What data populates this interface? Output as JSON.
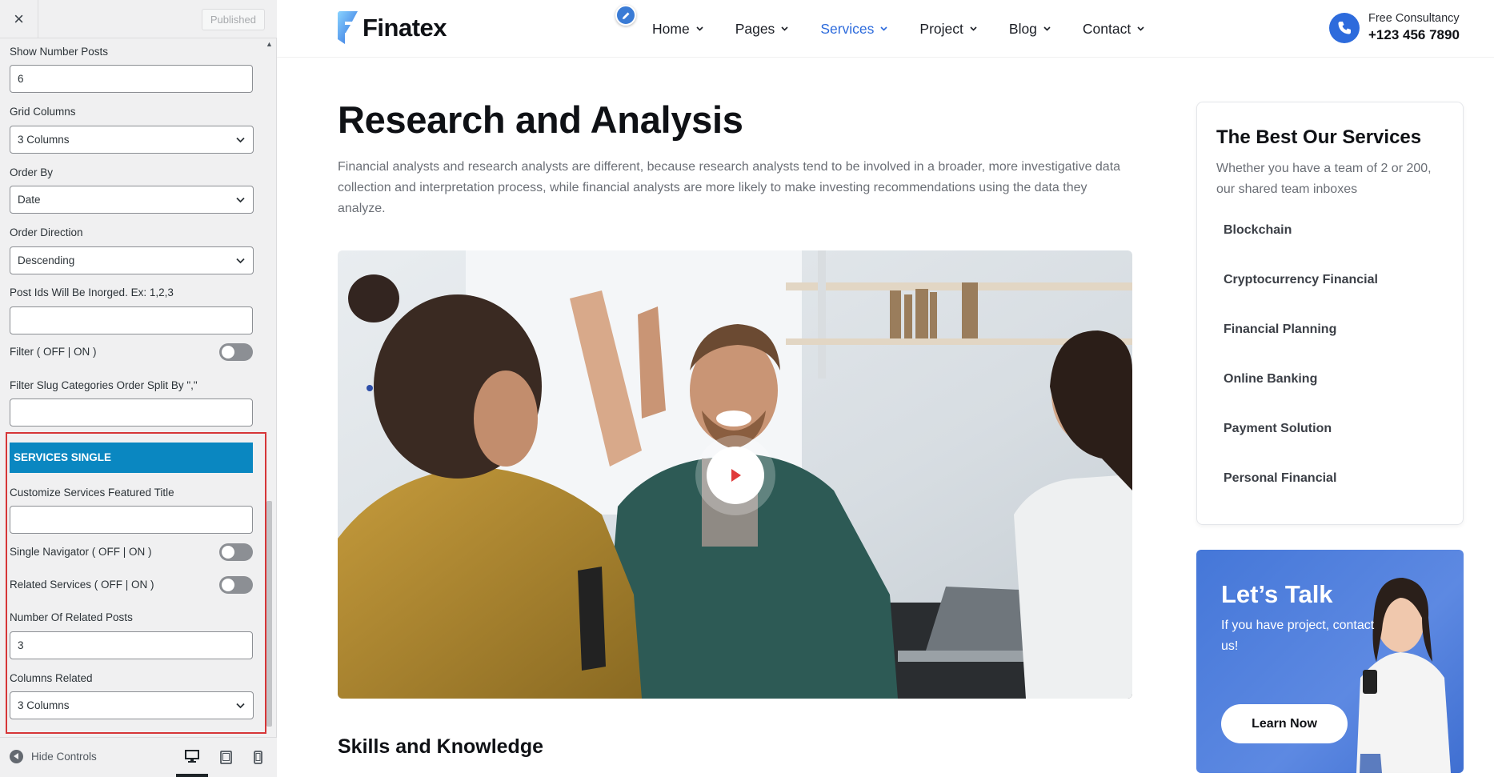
{
  "panel": {
    "close_icon": "×",
    "published_label": "Published",
    "fields": {
      "show_number_posts": {
        "label": "Show Number Posts",
        "value": "6"
      },
      "grid_columns": {
        "label": "Grid Columns",
        "value": "3 Columns"
      },
      "order_by": {
        "label": "Order By",
        "value": "Date"
      },
      "order_direction": {
        "label": "Order Direction",
        "value": "Descending"
      },
      "post_ids": {
        "label": "Post Ids Will Be Inorged. Ex: 1,2,3",
        "value": ""
      },
      "filter": {
        "label": "Filter ( OFF | ON )",
        "state": "off"
      },
      "filter_slug": {
        "label": "Filter Slug Categories Order Split By \",\"",
        "value": ""
      }
    },
    "section": {
      "title": "SERVICES SINGLE",
      "featured_title": {
        "label": "Customize Services Featured Title",
        "value": ""
      },
      "single_navigator": {
        "label": "Single Navigator ( OFF | ON )",
        "state": "off"
      },
      "related_services": {
        "label": "Related Services ( OFF | ON )",
        "state": "off"
      },
      "number_related": {
        "label": "Number Of Related Posts",
        "value": "3"
      },
      "columns_related": {
        "label": "Columns Related",
        "value": "3 Columns"
      }
    },
    "footer": {
      "hide_controls": "Hide Controls",
      "devices": [
        "desktop",
        "tablet",
        "mobile"
      ],
      "active_device": "desktop"
    }
  },
  "site": {
    "logo_text": "Finatex",
    "nav": [
      {
        "label": "Home",
        "active": false
      },
      {
        "label": "Pages",
        "active": false
      },
      {
        "label": "Services",
        "active": true
      },
      {
        "label": "Project",
        "active": false
      },
      {
        "label": "Blog",
        "active": false
      },
      {
        "label": "Contact",
        "active": false
      }
    ],
    "consult_label": "Free Consultancy",
    "consult_phone": "+123 456 7890",
    "accent_color": "#2d6bdc"
  },
  "main": {
    "title": "Research and Analysis",
    "description": "Financial analysts and research analysts are different, because research analysts tend to be involved in a broader, more investigative data collection and interpretation process, while financial analysts are more likely to make investing recommendations using the data they analyze.",
    "skills_title": "Skills and Knowledge"
  },
  "sidebar": {
    "services_title": "The Best Our Services",
    "services_sub": "Whether you have a team of 2 or 200, our shared team inboxes",
    "services": [
      "Blockchain",
      "Cryptocurrency Financial",
      "Financial Planning",
      "Online Banking",
      "Payment Solution",
      "Personal Financial"
    ],
    "talk_title": "Let’s Talk",
    "talk_sub": "If you have project, contact us!",
    "learn_label": "Learn Now"
  }
}
